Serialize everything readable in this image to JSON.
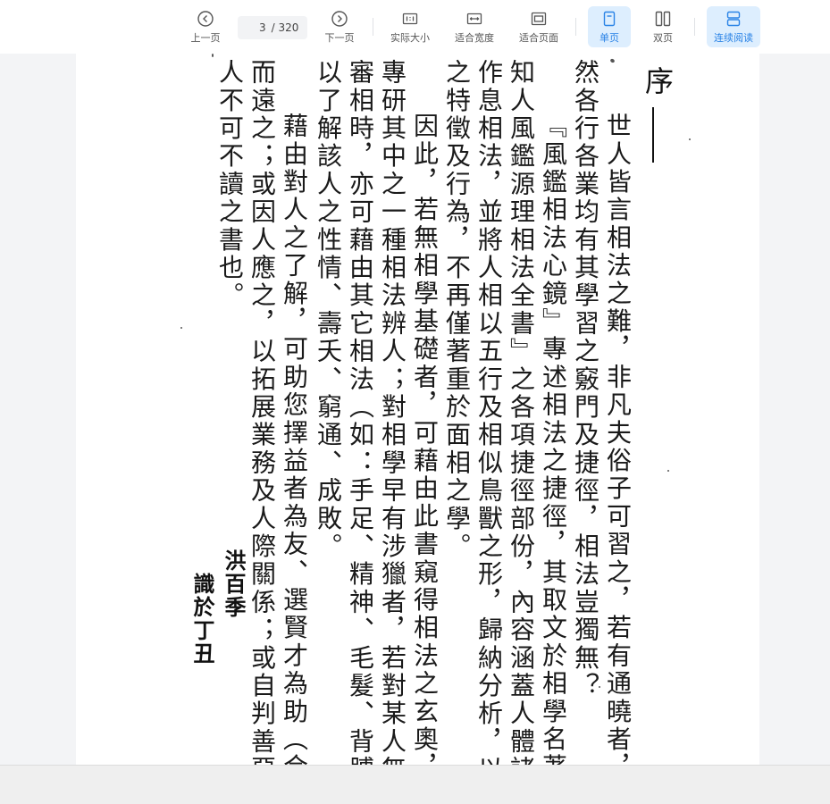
{
  "toolbar": {
    "prev_label": "上一页",
    "next_label": "下一页",
    "current_page": "3",
    "total_pages": "/ 320",
    "actual_size_label": "实际大小",
    "fit_width_label": "适合宽度",
    "fit_page_label": "适合页面",
    "single_page_label": "单页",
    "double_page_label": "双页",
    "continuous_label": "连续阅读",
    "active_accent": "#2a83e6",
    "active_bg": "#ddeefe"
  },
  "document": {
    "title": "序",
    "columns": [
      "世人皆言相法之難，非凡夫俗子可習之，若有通曉者，必",
      "然各行各業均有其學習之竅門及捷徑，相法豈獨無？",
      "『風鑑相法心鏡』專述相法之捷徑，其取文於相學名著『",
      "知人風鑑源理相法全書』之各項捷徑部份，內容涵蓋人體諸部",
      "作息相法，並將人相以五行及相似鳥獸之形，歸納分析，以闡",
      "之特徵及行為，不再僅著重於面相之學。",
      "因此，若無相學基礎者，可藉由此書窺得相法之玄奧，或於",
      "專研其中之一種相法辨人；對相學早有涉獵者，若對某人無法",
      "審相時，亦可藉由其它相法（如：手足、精神、毛髮、背膊……",
      "以了解該人之性情、壽夭、窮通、成敗。",
      "藉由對人之了解，可助您擇益者為友、選賢才為助（合夥",
      "而遠之；或因人應之，以拓展業務及人際關係；或自判善惡以",
      "人不可不讀之書也。"
    ],
    "signature_name": "洪百季",
    "signature_note": "識於丁丑"
  }
}
